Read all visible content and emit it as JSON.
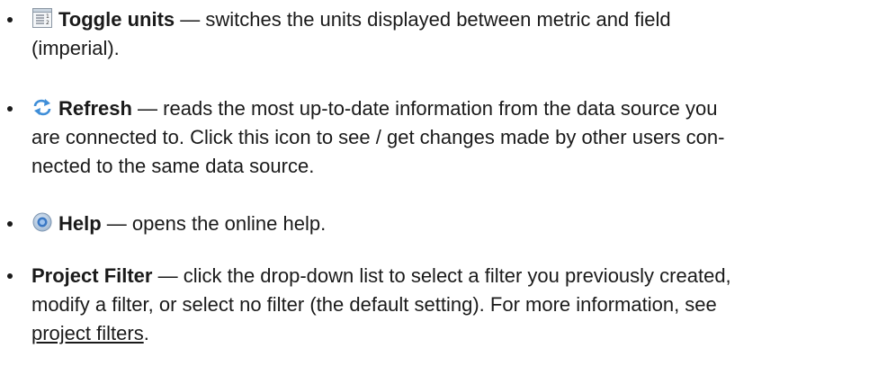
{
  "items": [
    {
      "icon": "toggle-units-icon",
      "name": "Toggle units",
      "dash": " — ",
      "line1": "switches the units displayed between metric and field",
      "line2": "(imperial)."
    },
    {
      "icon": "refresh-icon",
      "name": "Refresh",
      "dash": " — ",
      "line1": "reads the most up-to-date information from the data source you",
      "line2": "are connected to. Click this icon to see / get changes made by other users con-",
      "line3": "nected to the same data source."
    },
    {
      "icon": "help-icon",
      "name": "Help",
      "dash": " — ",
      "line1": "opens the online help."
    },
    {
      "name": "Project Filter",
      "dash": " — ",
      "line1": "click the drop-down list to select a filter you previously created,",
      "line2": "modify a filter, or select no filter (the default setting). For more information, see",
      "link": "project filters",
      "after_link": "."
    }
  ]
}
